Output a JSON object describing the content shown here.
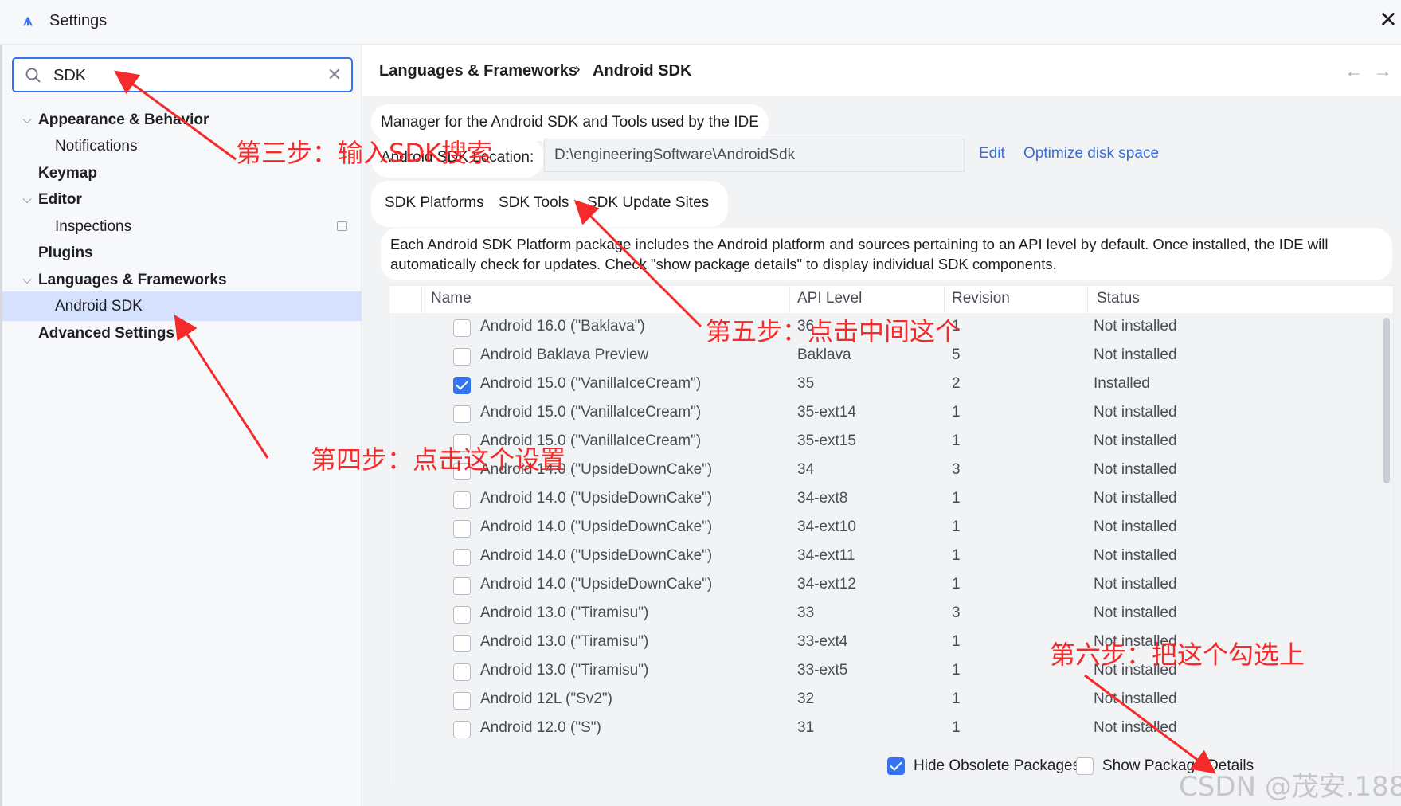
{
  "window": {
    "title": "Settings",
    "close_label": "✕"
  },
  "search": {
    "value": "SDK",
    "clear_label": "✕"
  },
  "sidebar": {
    "items": [
      {
        "label": "Appearance & Behavior"
      },
      {
        "label": "Notifications"
      },
      {
        "label": "Keymap"
      },
      {
        "label": "Editor"
      },
      {
        "label": "Inspections"
      },
      {
        "label": "Plugins"
      },
      {
        "label": "Languages & Frameworks"
      },
      {
        "label": "Android SDK"
      },
      {
        "label": "Advanced Settings"
      }
    ]
  },
  "header": {
    "crumb1": "Languages & Frameworks",
    "sep": "›",
    "crumb2": "Android SDK",
    "back": "←",
    "forward": "→"
  },
  "sdk": {
    "description": "Manager for the Android SDK and Tools used by the IDE",
    "location_label": "Android SDK Location:",
    "location_value": "D:\\engineeringSoftware\\AndroidSdk",
    "edit_link": "Edit",
    "optimize_link": "Optimize disk space"
  },
  "tabs": [
    {
      "label": "SDK Platforms"
    },
    {
      "label": "SDK Tools"
    },
    {
      "label": "SDK Update Sites"
    }
  ],
  "info": "Each Android SDK Platform package includes the Android platform and sources pertaining to an API level by default. Once installed, the IDE will automatically check for updates. Check \"show package details\" to display individual SDK components.",
  "table": {
    "headers": {
      "name": "Name",
      "api": "API Level",
      "revision": "Revision",
      "status": "Status"
    },
    "rows": [
      {
        "name": "Android 16.0 (\"Baklava\")",
        "api": "36",
        "revision": "1",
        "status": "Not installed",
        "checked": false
      },
      {
        "name": "Android Baklava Preview",
        "api": "Baklava",
        "revision": "5",
        "status": "Not installed",
        "checked": false
      },
      {
        "name": "Android 15.0 (\"VanillaIceCream\")",
        "api": "35",
        "revision": "2",
        "status": "Installed",
        "checked": true
      },
      {
        "name": "Android 15.0 (\"VanillaIceCream\")",
        "api": "35-ext14",
        "revision": "1",
        "status": "Not installed",
        "checked": false
      },
      {
        "name": "Android 15.0 (\"VanillaIceCream\")",
        "api": "35-ext15",
        "revision": "1",
        "status": "Not installed",
        "checked": false
      },
      {
        "name": "Android 14.0 (\"UpsideDownCake\")",
        "api": "34",
        "revision": "3",
        "status": "Not installed",
        "checked": false
      },
      {
        "name": "Android 14.0 (\"UpsideDownCake\")",
        "api": "34-ext8",
        "revision": "1",
        "status": "Not installed",
        "checked": false
      },
      {
        "name": "Android 14.0 (\"UpsideDownCake\")",
        "api": "34-ext10",
        "revision": "1",
        "status": "Not installed",
        "checked": false
      },
      {
        "name": "Android 14.0 (\"UpsideDownCake\")",
        "api": "34-ext11",
        "revision": "1",
        "status": "Not installed",
        "checked": false
      },
      {
        "name": "Android 14.0 (\"UpsideDownCake\")",
        "api": "34-ext12",
        "revision": "1",
        "status": "Not installed",
        "checked": false
      },
      {
        "name": "Android 13.0 (\"Tiramisu\")",
        "api": "33",
        "revision": "3",
        "status": "Not installed",
        "checked": false
      },
      {
        "name": "Android 13.0 (\"Tiramisu\")",
        "api": "33-ext4",
        "revision": "1",
        "status": "Not installed",
        "checked": false
      },
      {
        "name": "Android 13.0 (\"Tiramisu\")",
        "api": "33-ext5",
        "revision": "1",
        "status": "Not installed",
        "checked": false
      },
      {
        "name": "Android 12L (\"Sv2\")",
        "api": "32",
        "revision": "1",
        "status": "Not installed",
        "checked": false
      },
      {
        "name": "Android 12.0 (\"S\")",
        "api": "31",
        "revision": "1",
        "status": "Not installed",
        "checked": false
      }
    ]
  },
  "bottom": {
    "hide_obsolete_label": "Hide Obsolete Packages",
    "hide_obsolete_checked": true,
    "show_details_label": "Show Package Details",
    "show_details_checked": false
  },
  "annotations": {
    "step3": "第三步：输入SDK搜索",
    "step4": "第四步：点击这个设置",
    "step5": "第五步：点击中间这个",
    "step6": "第六步：把这个勾选上",
    "color": "#f52a2a"
  },
  "watermark": "CSDN @茂安.188",
  "colors": {
    "accent": "#3574f0",
    "selection": "#d5e1ff",
    "link": "#3a6bd8"
  }
}
